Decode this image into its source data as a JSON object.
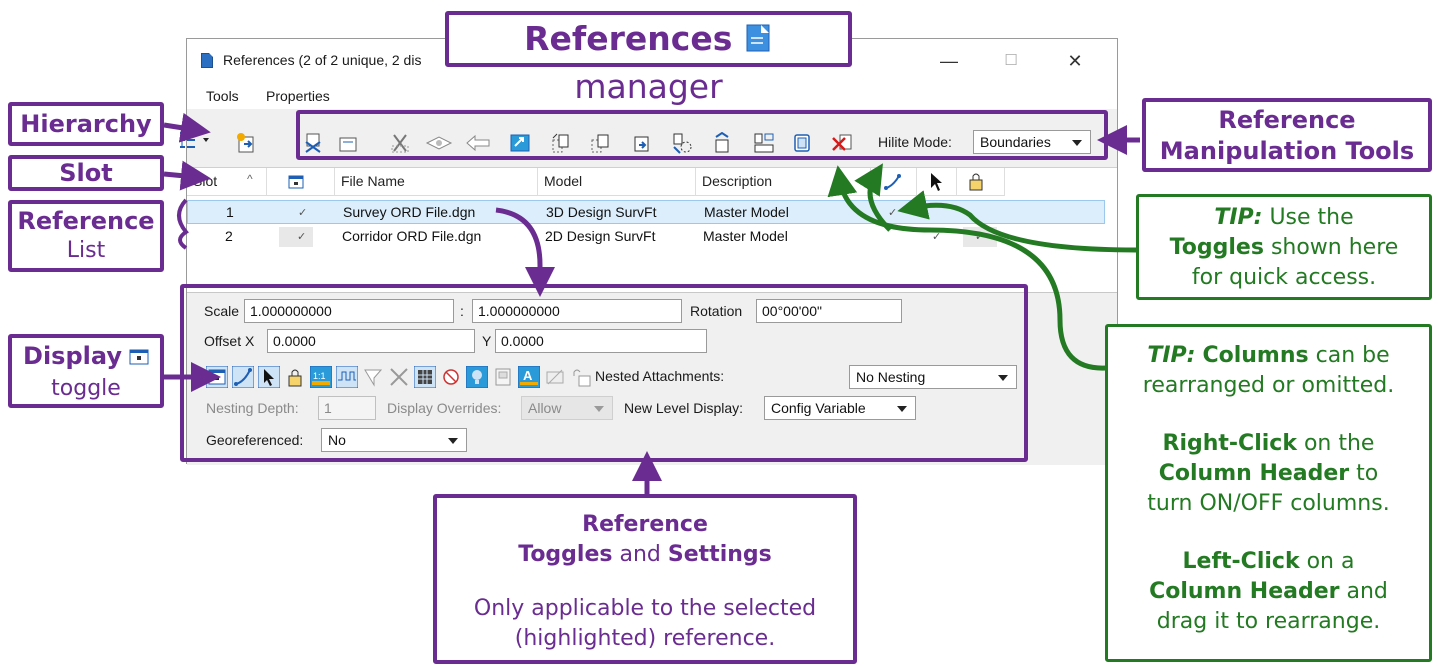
{
  "window": {
    "title": "References (2 of 2 unique, 2 dis",
    "controls": {
      "minimize": "—",
      "maximize": "☐",
      "close": "✕"
    }
  },
  "menu": {
    "tools": "Tools",
    "properties": "Properties"
  },
  "toolbar": {
    "hilite_label": "Hilite Mode:",
    "hilite_value": "Boundaries",
    "icons": [
      "hierarchy-icon",
      "attach-icon",
      "detach-icon",
      "reload-icon",
      "clip-boundary-icon",
      "clip-mask-icon",
      "clip-delete-icon",
      "move-icon",
      "copy-icon",
      "scale-icon",
      "rotate-icon",
      "mirror-horizontal-icon",
      "mirror-vertical-icon",
      "exchange-icon",
      "merge-icon",
      "make-direct-icon",
      "delete-reference-icon"
    ]
  },
  "grid": {
    "columns": [
      "Slot",
      "File Name",
      "Model",
      "Description"
    ],
    "rows": [
      {
        "slot": "1",
        "file": "Survey ORD File.dgn",
        "model": "3D Design SurvFt",
        "description": "Master Model",
        "display": "✓",
        "snap": "✓"
      },
      {
        "slot": "2",
        "file": "Corridor ORD File.dgn",
        "model": "2D Design SurvFt",
        "description": "Master Model",
        "display": "✓",
        "locate": "✓",
        "lock": "✓"
      }
    ]
  },
  "settings": {
    "scale_label": "Scale",
    "scale_value1": "1.000000000",
    "scale_sep": ":",
    "scale_value2": "1.000000000",
    "rotation_label": "Rotation",
    "rotation_value": "00°00'00\"",
    "offset_x_label": "Offset X",
    "offset_x_value": "0.0000",
    "offset_y_label": "Y",
    "offset_y_value": "0.0000",
    "nested_label": "Nested Attachments:",
    "nested_value": "No Nesting",
    "nesting_depth_label": "Nesting Depth:",
    "nesting_depth_value": "1",
    "display_overrides_label": "Display Overrides:",
    "display_overrides_value": "Allow",
    "new_level_label": "New Level Display:",
    "new_level_value": "Config Variable",
    "georef_label": "Georeferenced:",
    "georef_value": "No"
  },
  "callouts": {
    "title_a": "References",
    "title_b": "manager",
    "hierarchy": "Hierarchy",
    "slot": "Slot",
    "reference": "Reference",
    "list": "List",
    "display": "Display",
    "toggle": "toggle",
    "manip_1": "Reference",
    "manip_2": "Manipulation Tools",
    "tip1_tip": "TIP:",
    "tip1_use": "Use the",
    "tip1_toggles": "Toggles",
    "tip1_shown": "shown here",
    "tip1_quick": "for quick access.",
    "tip2_tip": "TIP:",
    "tip2_columns": "Columns",
    "tip2_canbe": "can be",
    "tip2_rearranged": "rearranged or omitted.",
    "tip2_right": "Right-Click",
    "tip2_onthe": "on the",
    "tip2_header": "Column Header",
    "tip2_to": "to",
    "tip2_turn": "turn ON/OFF columns.",
    "tip2_left": "Left-Click",
    "tip2_ona": "on a",
    "tip2_header2": "Column Header",
    "tip2_and": "and",
    "tip2_drag": "drag it to rearrange.",
    "toggles_1": "Reference",
    "toggles_2a": "Toggles",
    "toggles_2b": "and",
    "toggles_2c": "Settings",
    "toggles_3": "Only applicable to the selected",
    "toggles_4": "(highlighted) reference."
  },
  "colors": {
    "purple": "#6a2c91",
    "green": "#237a22",
    "selection": "#dceefc"
  }
}
